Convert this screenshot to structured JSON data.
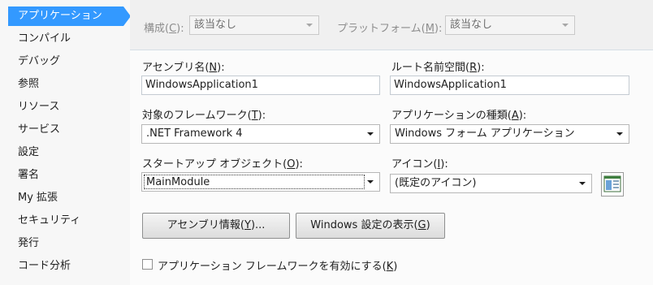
{
  "sidebar": {
    "items": [
      {
        "label": "アプリケーション",
        "selected": true
      },
      {
        "label": "コンパイル"
      },
      {
        "label": "デバッグ"
      },
      {
        "label": "参照"
      },
      {
        "label": "リソース"
      },
      {
        "label": "サービス"
      },
      {
        "label": "設定"
      },
      {
        "label": "署名"
      },
      {
        "label": "My 拡張"
      },
      {
        "label": "セキュリティ"
      },
      {
        "label": "発行"
      },
      {
        "label": "コード分析"
      }
    ]
  },
  "topbar": {
    "configuration": {
      "label": "構成(",
      "key": "C",
      "label_end": "):",
      "value": "該当なし"
    },
    "platform": {
      "label": "プラットフォーム(",
      "key": "M",
      "label_end": "):",
      "value": "該当なし"
    }
  },
  "form": {
    "assembly_name": {
      "label": "アセンブリ名(",
      "key": "N",
      "label_end": "):",
      "value": "WindowsApplication1"
    },
    "root_namespace": {
      "label": "ルート名前空間(",
      "key": "R",
      "label_end": "):",
      "value": "WindowsApplication1"
    },
    "target_framework": {
      "label": "対象のフレームワーク(",
      "key": "T",
      "label_end": "):",
      "value": ".NET Framework 4"
    },
    "application_type": {
      "label": "アプリケーションの種類(",
      "key": "A",
      "label_end": "):",
      "value": "Windows フォーム アプリケーション"
    },
    "startup_object": {
      "label": "スタートアップ オブジェクト(",
      "key": "O",
      "label_end": "):",
      "value": "MainModule"
    },
    "icon": {
      "label": "アイコン(",
      "key": "I",
      "label_end": "):",
      "value": "(既定のアイコン)"
    }
  },
  "buttons": {
    "assembly_info": {
      "label": "アセンブリ情報(",
      "key": "Y",
      "label_end": ")..."
    },
    "windows_settings": {
      "label": "Windows 設定の表示(",
      "key": "G",
      "label_end": ")"
    }
  },
  "checkbox": {
    "label": "アプリケーション フレームワークを有効にする(",
    "key": "K",
    "label_end": ")",
    "checked": false
  },
  "colors": {
    "selection": "#3399ff"
  }
}
